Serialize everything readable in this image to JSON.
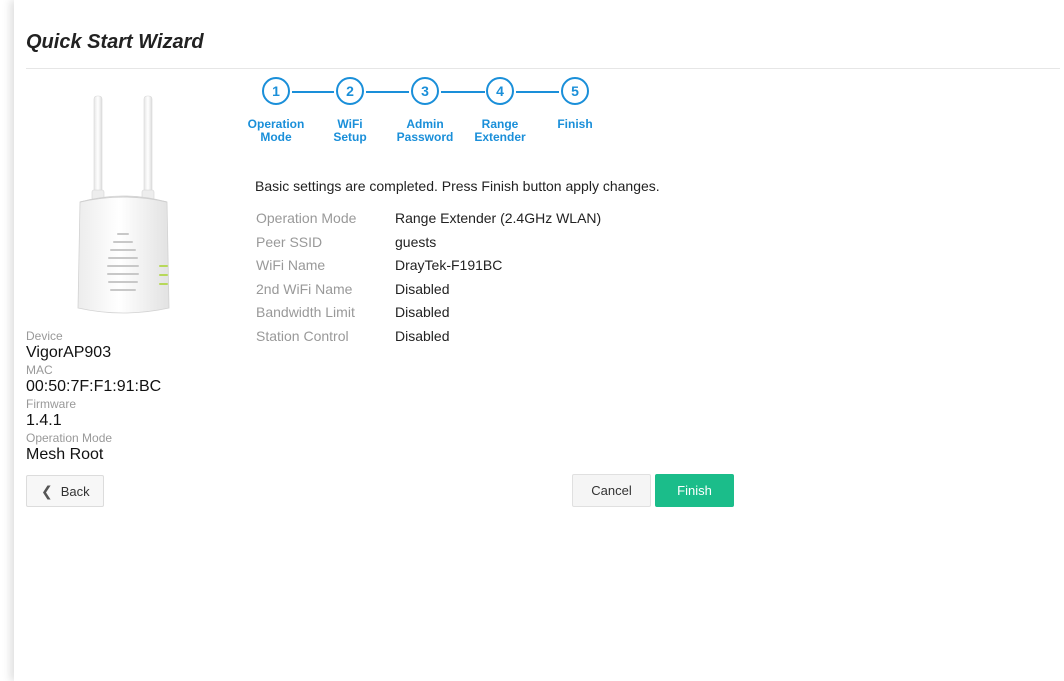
{
  "header": {
    "title": "Quick Start Wizard"
  },
  "steps": [
    {
      "number": "1",
      "label": "Operation Mode"
    },
    {
      "number": "2",
      "label": "WiFi Setup"
    },
    {
      "number": "3",
      "label": "Admin Password"
    },
    {
      "number": "4",
      "label": "Range Extender"
    },
    {
      "number": "5",
      "label": "Finish"
    }
  ],
  "device_info": {
    "device_label": "Device",
    "device_value": "VigorAP903",
    "mac_label": "MAC",
    "mac_value": "00:50:7F:F1:91:BC",
    "firmware_label": "Firmware",
    "firmware_value": "1.4.1",
    "opmode_label": "Operation Mode",
    "opmode_value": "Mesh Root"
  },
  "summary": {
    "intro": "Basic settings are completed. Press Finish button apply changes.",
    "rows": [
      {
        "key": "Operation Mode",
        "value": "Range Extender (2.4GHz WLAN)"
      },
      {
        "key": "Peer SSID",
        "value": "guests"
      },
      {
        "key": "WiFi Name",
        "value": "DrayTek-F191BC"
      },
      {
        "key": "2nd WiFi Name",
        "value": "Disabled"
      },
      {
        "key": "Bandwidth Limit",
        "value": "Disabled"
      },
      {
        "key": "Station Control",
        "value": "Disabled"
      }
    ]
  },
  "buttons": {
    "back": "Back",
    "cancel": "Cancel",
    "finish": "Finish"
  },
  "colors": {
    "accent": "#1a8fd9",
    "finish": "#1bbd8a"
  }
}
